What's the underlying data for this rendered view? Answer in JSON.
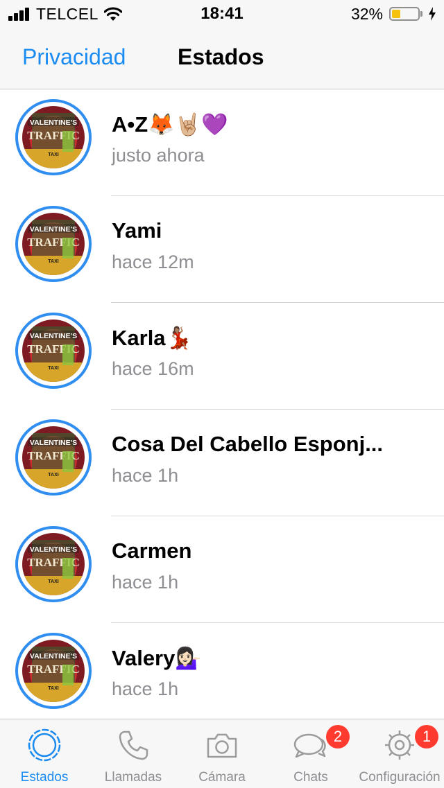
{
  "status_bar": {
    "carrier": "TELCEL",
    "time": "18:41",
    "battery_percent_label": "32%",
    "battery_level": 0.32
  },
  "nav": {
    "back_label": "Privacidad",
    "title": "Estados"
  },
  "statuses": [
    {
      "name": "A•Z🦊🤘🏼💜",
      "time": "justo ahora"
    },
    {
      "name": "Yami",
      "time": "hace 12m"
    },
    {
      "name": "Karla💃🏽",
      "time": "hace 16m"
    },
    {
      "name": "Cosa Del Cabello Esponj...",
      "time": "hace 1h"
    },
    {
      "name": "Carmen",
      "time": "hace 1h"
    },
    {
      "name": "Valery💁🏻‍♀️",
      "time": "hace 1h"
    }
  ],
  "avatar": {
    "text_top": "VALENTINE'S",
    "text_main": "TRAFFIC",
    "text_sub": "TAXI"
  },
  "tabs": [
    {
      "label": "Estados",
      "icon": "status-ring-icon",
      "active": true
    },
    {
      "label": "Llamadas",
      "icon": "phone-icon",
      "active": false
    },
    {
      "label": "Cámara",
      "icon": "camera-icon",
      "active": false
    },
    {
      "label": "Chats",
      "icon": "chat-bubbles-icon",
      "active": false,
      "badge": "2"
    },
    {
      "label": "Configuración",
      "icon": "gear-icon",
      "active": false,
      "badge": "1"
    }
  ],
  "colors": {
    "accent": "#1a8bf0",
    "status_ring": "#2f8ef0",
    "badge": "#ff3b30",
    "battery": "#f5c20f"
  }
}
